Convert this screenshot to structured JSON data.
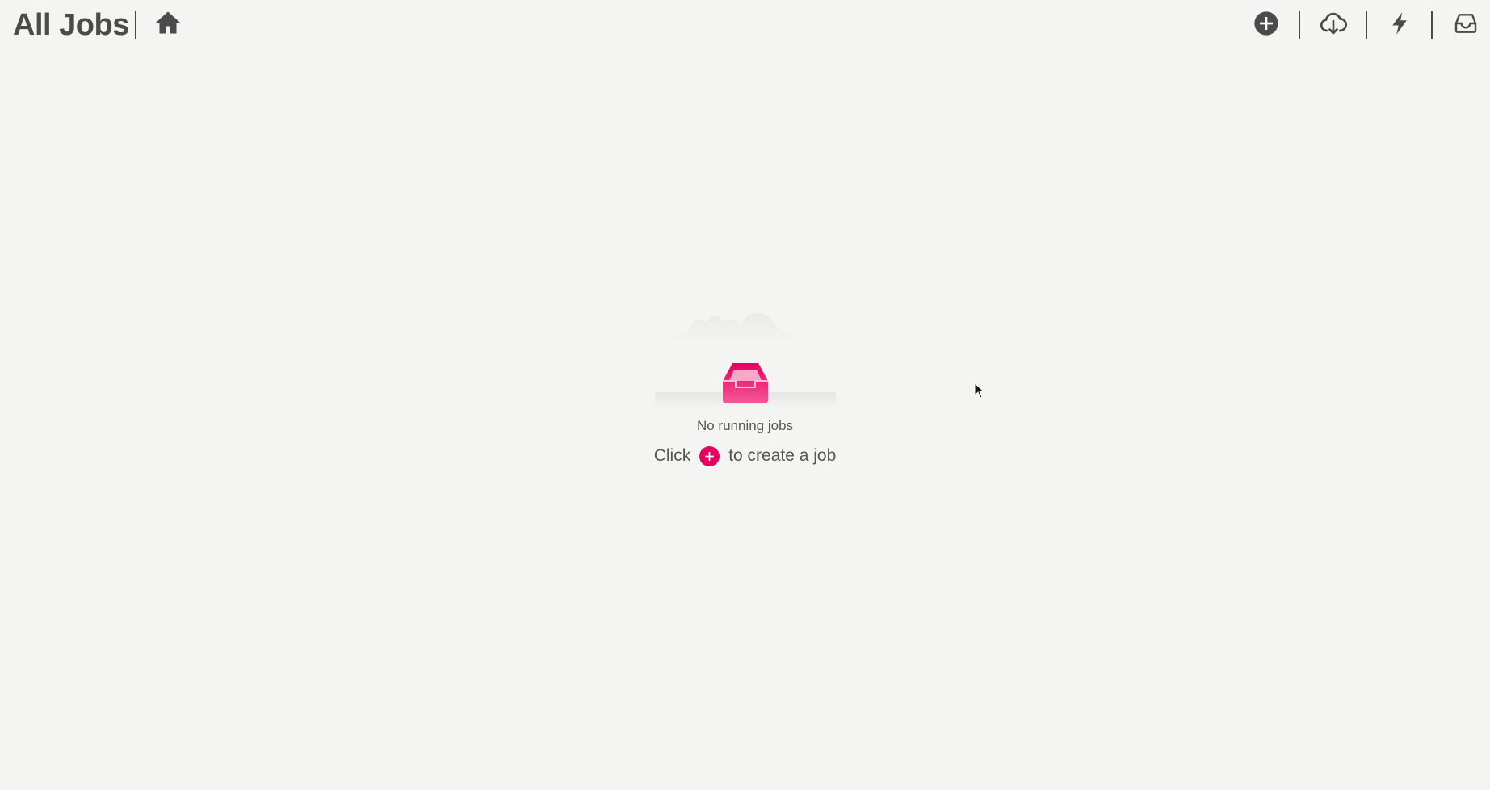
{
  "header": {
    "title": "All Jobs",
    "home_icon": "home-icon"
  },
  "toolbar": {
    "icons": [
      "add-circle-icon",
      "cloud-download-icon",
      "lightning-bolt-icon",
      "inbox-icon"
    ]
  },
  "empty_state": {
    "illustration": "empty-inbox-illustration",
    "message": "No running jobs",
    "hint_prefix": "Click",
    "hint_suffix": "to create a job"
  },
  "colors": {
    "accent": "#e8005f",
    "icon": "#4b4b4b",
    "background": "#f4f5f2"
  }
}
